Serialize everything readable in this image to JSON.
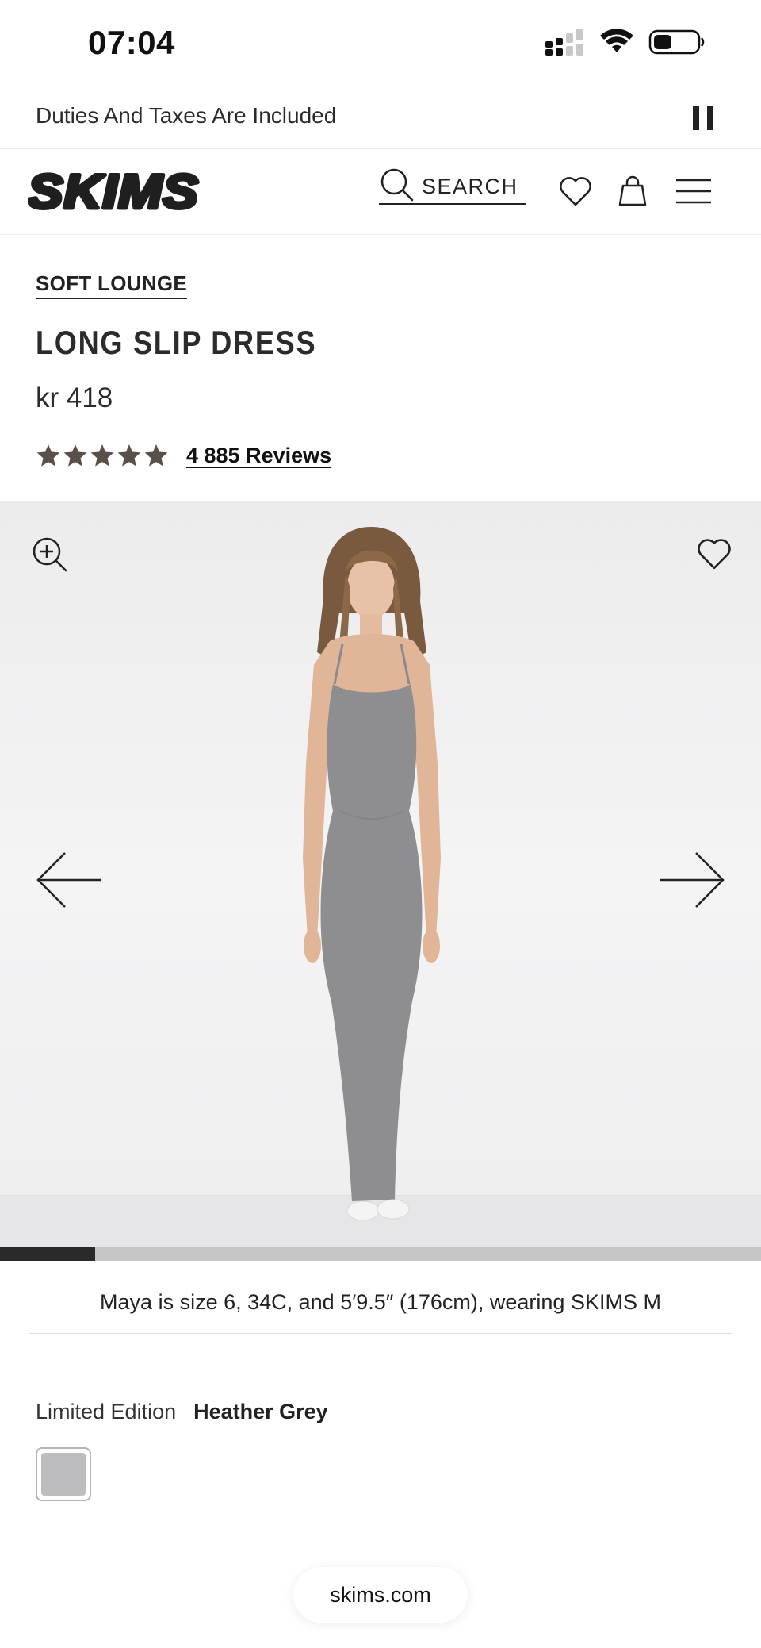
{
  "status_bar": {
    "time": "07:04",
    "icons": [
      "cellular-signal-icon",
      "wifi-icon",
      "battery-icon"
    ]
  },
  "promo": {
    "text": "Duties And Taxes Are Included",
    "control_icon": "pause-icon"
  },
  "header": {
    "logo_text": "SKIMS",
    "search_label": "SEARCH",
    "icons": [
      "search-icon",
      "heart-icon",
      "shopping-bag-icon",
      "hamburger-menu-icon"
    ]
  },
  "product": {
    "category": "SOFT LOUNGE",
    "title": "LONG SLIP DRESS",
    "price": "kr 418",
    "rating_stars": 5,
    "reviews_link": "4 885 Reviews"
  },
  "gallery": {
    "icons": [
      "zoom-in-icon",
      "heart-icon",
      "arrow-left-icon",
      "arrow-right-icon"
    ],
    "progress": 0.125
  },
  "model_caption": "Maya is size 6, 34C, and 5′9.5″ (176cm), wearing SKIMS M",
  "color": {
    "label": "Limited Edition",
    "selected_name": "Heather Grey",
    "swatch_color": "#bdbdbf"
  },
  "browser": {
    "url": "skims.com"
  },
  "colors": {
    "star": "#5b5049",
    "text": "#222222",
    "progress_fill": "#2a2a2a",
    "progress_track": "#c6c6c7"
  }
}
